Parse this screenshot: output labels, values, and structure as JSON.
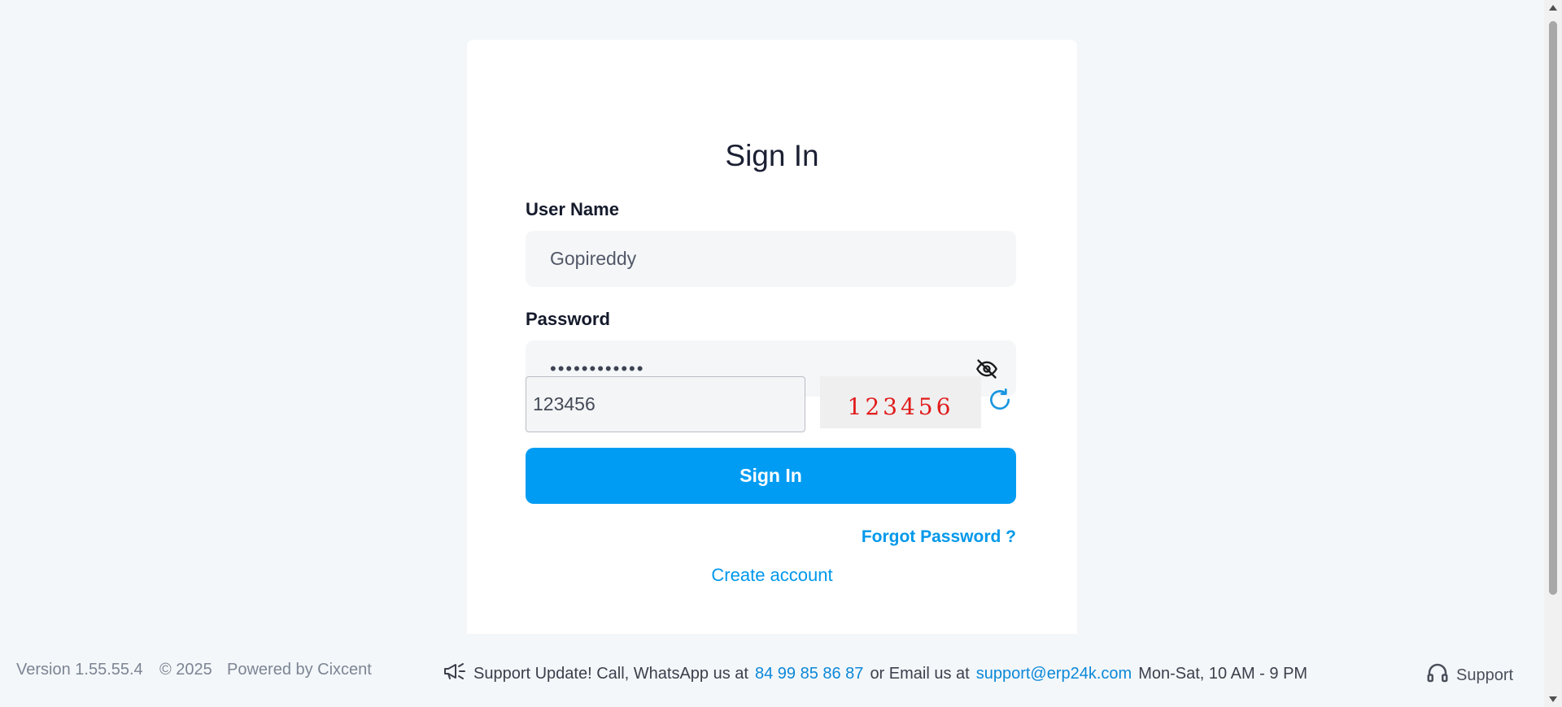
{
  "signin": {
    "title": "Sign In",
    "username_label": "User Name",
    "username_value": "Gopireddy",
    "password_label": "Password",
    "password_value_masked": "••••••••••••",
    "captcha_input_value": "123456",
    "captcha_image_text": "123456",
    "submit_label": "Sign In",
    "forgot_password": "Forgot Password ?",
    "create_account": "Create account"
  },
  "footer": {
    "version": "Version 1.55.55.4",
    "copyright": "© 2025",
    "powered_by": "Powered by Cixcent",
    "support_prefix": "Support Update! Call, WhatsApp us at",
    "phone": "84 99 85 86 87",
    "email_prefix": "or Email us at",
    "email": "support@erp24k.com",
    "hours": "Mon-Sat, 10 AM - 9 PM",
    "support_label": "Support"
  },
  "icons": {
    "password_toggle": "eye-slash-icon",
    "captcha_refresh": "refresh-icon",
    "announcement": "megaphone-icon",
    "support": "headset-icon"
  },
  "colors": {
    "accent": "#009cf3",
    "link": "#0098ea",
    "captcha_text": "#e11b1b",
    "background": "#f4f7fa"
  }
}
